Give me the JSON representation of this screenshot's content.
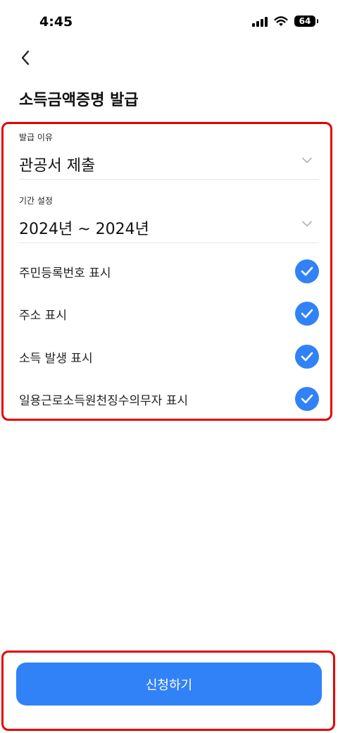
{
  "status_bar": {
    "time": "4:45",
    "battery_level": "64",
    "icons": [
      "signal-icon",
      "wifi-icon",
      "battery-icon"
    ]
  },
  "header": {
    "back_icon": "chevron-left-icon",
    "title": "소득금액증명 발급"
  },
  "form": {
    "reason": {
      "label": "발급 이유",
      "value": "관공서 제출",
      "icon": "chevron-down-icon"
    },
    "period": {
      "label": "기간 설정",
      "value": "2024년 ~ 2024년",
      "icon": "chevron-down-icon"
    },
    "options": [
      {
        "label": "주민등록번호 표시",
        "checked": true
      },
      {
        "label": "주소 표시",
        "checked": true
      },
      {
        "label": "소득 발생 표시",
        "checked": true
      },
      {
        "label": "일용근로소득원천징수의무자 표시",
        "checked": true
      }
    ]
  },
  "submit": {
    "label": "신청하기"
  },
  "colors": {
    "accent": "#3182f6",
    "highlight_border": "#e60000",
    "text": "#111111",
    "divider": "#e6e6e6"
  }
}
